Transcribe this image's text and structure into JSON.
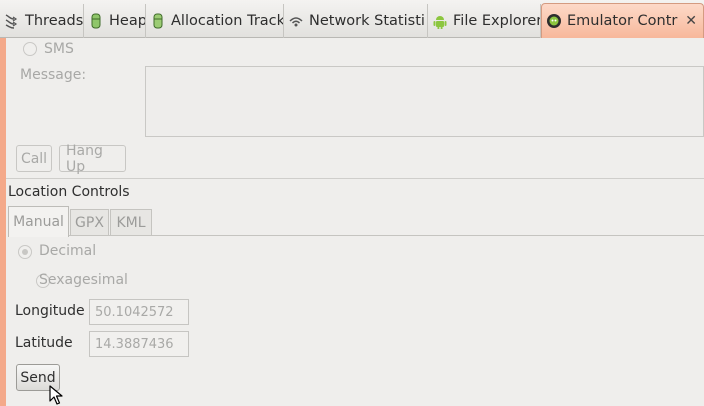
{
  "tabs": [
    {
      "label": "Threads",
      "icon": "threads-icon"
    },
    {
      "label": "Heap",
      "icon": "heap-icon"
    },
    {
      "label": "Allocation Track",
      "icon": "allocation-icon"
    },
    {
      "label": "Network Statisti",
      "icon": "network-icon"
    },
    {
      "label": "File Explorer",
      "icon": "android-icon"
    },
    {
      "label": "Emulator Contr",
      "icon": "emulator-icon",
      "active": true
    }
  ],
  "close_glyph": "✕",
  "telephony": {
    "sms_label": "SMS",
    "message_label": "Message:",
    "call_button": "Call",
    "hangup_button": "Hang Up"
  },
  "location": {
    "section_title": "Location Controls",
    "tabs": [
      "Manual",
      "GPX",
      "KML"
    ],
    "decimal_label": "Decimal",
    "sexagesimal_label": "Sexagesimal",
    "longitude_label": "Longitude",
    "longitude_value": "50.1042572",
    "latitude_label": "Latitude",
    "latitude_value": "14.3887436",
    "send_button": "Send"
  },
  "colors": {
    "active_tab": "#f7b89b",
    "accent_border": "#f4a98a"
  }
}
